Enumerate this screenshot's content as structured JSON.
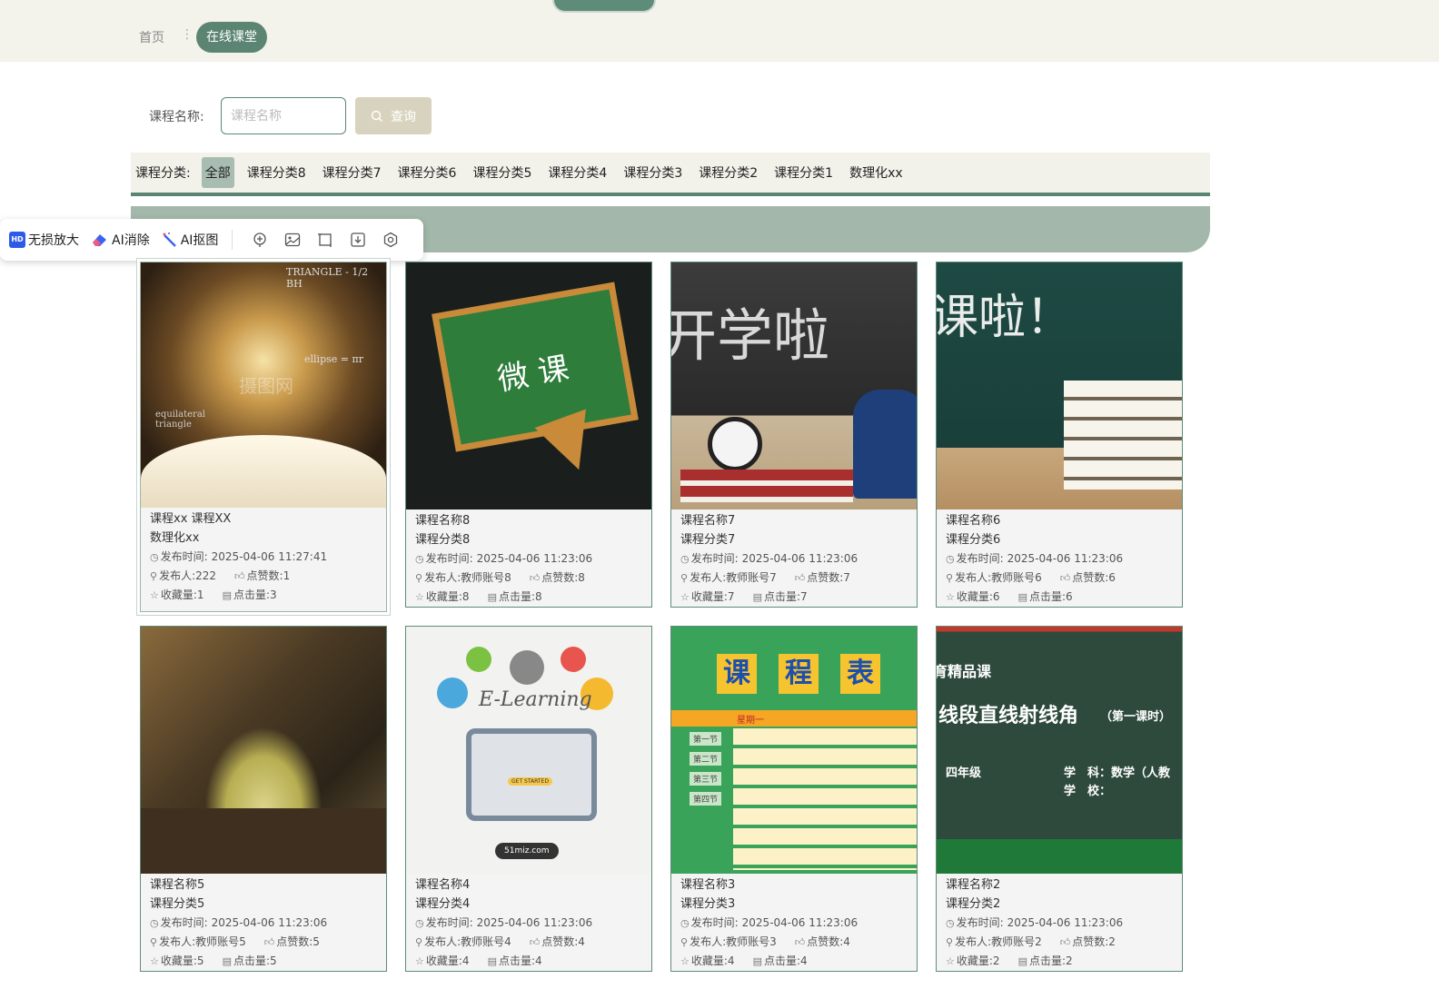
{
  "nav": {
    "home": "首页",
    "separator": "⋮",
    "current": "在线课堂"
  },
  "search": {
    "label": "课程名称:",
    "placeholder": "课程名称",
    "button": "查询"
  },
  "categories": {
    "label": "课程分类:",
    "items": [
      "全部",
      "课程分类8",
      "课程分类7",
      "课程分类6",
      "课程分类5",
      "课程分类4",
      "课程分类3",
      "课程分类2",
      "课程分类1",
      "数理化xx"
    ],
    "active": "全部"
  },
  "ai_toolbar": {
    "upscale": "无损放大",
    "erase": "AI消除",
    "cutout": "AI抠图"
  },
  "meta_labels": {
    "time": "发布时间:",
    "author": "发布人:",
    "likes": "点赞数:",
    "favorites": "收藏量:",
    "clicks": "点击量:"
  },
  "courses": [
    {
      "title": "课程xx  课程XX",
      "category": "数理化xx",
      "time": "2025-04-06 11:27:41",
      "author": "222",
      "likes": "1",
      "favorites": "1",
      "clicks": "3",
      "image_texts": [
        "TRIANGLE - 1/2 BH",
        "equilateral triangle",
        "ellipse = πr",
        "摄图网"
      ]
    },
    {
      "title": "课程名称8",
      "category": "课程分类8",
      "time": "2025-04-06 11:23:06",
      "author": "教师账号8",
      "likes": "8",
      "favorites": "8",
      "clicks": "8",
      "image_texts": [
        "微 课"
      ]
    },
    {
      "title": "课程名称7",
      "category": "课程分类7",
      "time": "2025-04-06 11:23:06",
      "author": "教师账号7",
      "likes": "7",
      "favorites": "7",
      "clicks": "7",
      "image_texts": [
        "开学啦"
      ]
    },
    {
      "title": "课程名称6",
      "category": "课程分类6",
      "time": "2025-04-06 11:23:06",
      "author": "教师账号6",
      "likes": "6",
      "favorites": "6",
      "clicks": "6",
      "image_texts": [
        "课啦！"
      ]
    },
    {
      "title": "课程名称5",
      "category": "课程分类5",
      "time": "2025-04-06 11:23:06",
      "author": "教师账号5",
      "likes": "5",
      "favorites": "5",
      "clicks": "5",
      "image_texts": []
    },
    {
      "title": "课程名称4",
      "category": "课程分类4",
      "time": "2025-04-06 11:23:06",
      "author": "教师账号4",
      "likes": "4",
      "favorites": "4",
      "clicks": "4",
      "image_texts": [
        "E-Learning",
        "GET STARTED",
        "51miz.com"
      ]
    },
    {
      "title": "课程名称3",
      "category": "课程分类3",
      "time": "2025-04-06 11:23:06",
      "author": "教师账号3",
      "likes": "4",
      "favorites": "4",
      "clicks": "4",
      "image_texts": [
        "课",
        "程",
        "表",
        "星期一",
        "第一节",
        "第二节",
        "第三节",
        "第四节"
      ]
    },
    {
      "title": "课程名称2",
      "category": "课程分类2",
      "time": "2025-04-06 11:23:06",
      "author": "教师账号2",
      "likes": "2",
      "favorites": "2",
      "clicks": "2",
      "image_texts": [
        "育精品课",
        "线段直线射线角",
        "（第一课时）",
        "四年级",
        "学　科：数学（人教",
        "学　校："
      ]
    }
  ]
}
